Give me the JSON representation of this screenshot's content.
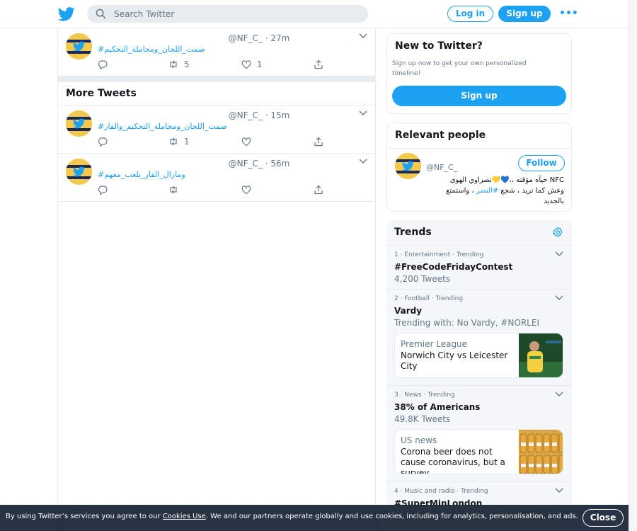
{
  "header": {
    "search_placeholder": "Search Twitter",
    "login_label": "Log in",
    "signup_label": "Sign up",
    "more_label": "•••"
  },
  "top_tweet": {
    "name": "ﾠﾠﾠﾠﾠﾠﾠﾠﾠ ﾠﾠﾠﾠﾠﾠﾠ",
    "handle": "@NF_C_",
    "time": "· 27m",
    "text": "#صمت_اللجان_ومجاملة_التحكيم",
    "retweets": "5",
    "likes": "1"
  },
  "more_tweets": {
    "heading": "More Tweets",
    "items": [
      {
        "name": "ﾠﾠﾠﾠﾠﾠﾠﾠﾠ ﾠﾠﾠﾠﾠﾠﾠ",
        "handle": "@NF_C_",
        "time": "· 15m",
        "text": "#صمت_اللجان_ومجاملة_التحكيم_والفار",
        "retweets": "1",
        "likes": ""
      },
      {
        "name": "ﾠﾠﾠﾠﾠﾠﾠﾠﾠ ﾠﾠﾠﾠﾠﾠﾠ",
        "handle": "@NF_C_",
        "time": "· 56m",
        "text": "#ومازال_الفار_يلعب_معهم",
        "retweets": "",
        "likes": ""
      }
    ]
  },
  "new_to_twitter": {
    "title": "New to Twitter?",
    "description": "Sign up now to get your own personalized timeline!",
    "button": "Sign up"
  },
  "relevant_people": {
    "title": "Relevant people",
    "person": {
      "name": "ﾠﾠﾠﾠﾠﾠﾠﾠﾠ ﾠﾠﾠﾠﾠﾠﾠ",
      "handle": "@NF_C_",
      "follow_label": "Follow",
      "bio_line1": "NFC حيآه مؤقته ،،💙💛نصراوي الهوى",
      "bio_line2a": "وعش كما تريد ، شجع",
      "bio_hashtag": "#النصر",
      "bio_line2b": "، واستمتع",
      "bio_line3": "بالجديد"
    }
  },
  "trends": {
    "title": "Trends",
    "items": [
      {
        "meta": "1 · Entertainment · Trending",
        "title": "#FreeCodeFridayContest",
        "sub": "4,200 Tweets"
      },
      {
        "meta": "2 · Football · Trending",
        "title": "Vardy",
        "sub": "Trending with: No Vardy, #NORLEI",
        "news_source": "Premier League",
        "news_headline": "Norwich City vs Leicester City"
      },
      {
        "meta": "3 · News · Trending",
        "title": "38% of Americans",
        "sub": "49.8K Tweets",
        "news_source": "US news",
        "news_headline": "Corona beer does not cause coronavirus, but a survey ..."
      },
      {
        "meta": "4 · Music and radio · Trending",
        "title": "#SuperMinLondon",
        "sub": ""
      }
    ]
  },
  "cookie_bar": {
    "text_before": "By using Twitter’s services you agree to our ",
    "link": "Cookies Use",
    "text_after": ". We and our partners operate globally and use cookies, including for analytics, personalisation, and ads.",
    "close_label": "Close"
  },
  "colors": {
    "accent": "#1da1f2",
    "text": "#14171a",
    "muted": "#657786",
    "border": "#e6ecf0",
    "cookie_bg": "#1c2938"
  },
  "icons": [
    "twitter-logo-icon",
    "search-icon",
    "chevron-down-icon",
    "reply-icon",
    "retweet-icon",
    "like-icon",
    "share-icon",
    "gear-icon"
  ]
}
